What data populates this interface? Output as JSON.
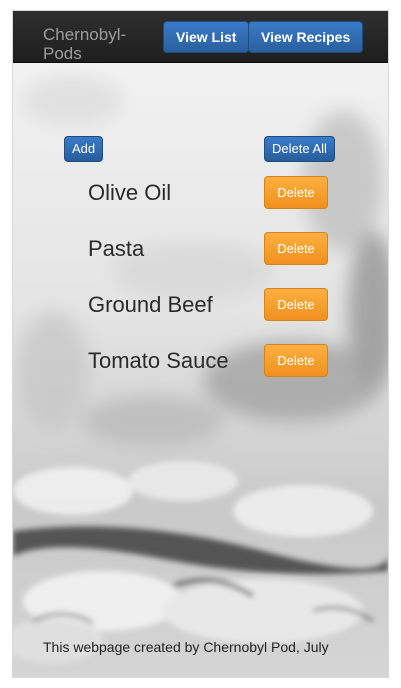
{
  "app": {
    "brand": "Chernobyl-Pods"
  },
  "nav": {
    "view_list": "View List",
    "view_recipes": "View Recipes"
  },
  "toolbar": {
    "add_label": "Add",
    "delete_all_label": "Delete All"
  },
  "items": [
    {
      "name": "Olive Oil",
      "delete_label": "Delete"
    },
    {
      "name": "Pasta",
      "delete_label": "Delete"
    },
    {
      "name": "Ground Beef",
      "delete_label": "Delete"
    },
    {
      "name": "Tomato Sauce",
      "delete_label": "Delete"
    }
  ],
  "footer": {
    "text": "This webpage created by Chernobyl Pod, July"
  },
  "colors": {
    "navbar": "#222222",
    "primary": "#2f6db3",
    "warning": "#f39c24"
  }
}
